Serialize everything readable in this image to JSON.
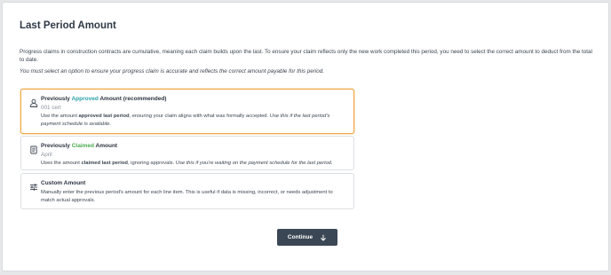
{
  "page": {
    "title": "Last Period Amount",
    "intro": "Progress claims in construction contracts are cumulative, meaning each claim builds upon the last. To ensure your claim reflects only the new work completed this period, you need to select the correct amount to deduct from the total to date.",
    "warning": "You must select an option to ensure your progress claim is accurate and reflects the correct amount payable for this period."
  },
  "options": [
    {
      "title_pre": "Previously ",
      "title_highlight": "Approved",
      "title_post": " Amount (recommended)",
      "subtitle": "001 cert",
      "desc_pre": "Use the amount ",
      "desc_bold": "approved last period",
      "desc_mid": ", ensuring your claim aligns with what was formally accepted. ",
      "desc_italic": "Use this if the last period's payment schedule is available.",
      "selected": true,
      "icon": "user-approved-icon"
    },
    {
      "title_pre": "Previously ",
      "title_highlight": "Claimed",
      "title_post": " Amount",
      "subtitle": "April",
      "desc_pre": "Uses the amount ",
      "desc_bold": "claimed last period",
      "desc_mid": ", ignoring approvals. ",
      "desc_italic": "Use this if you're waiting on the payment schedule for the last period.",
      "selected": false,
      "icon": "document-icon"
    },
    {
      "title": "Custom Amount",
      "desc": "Manually enter the previous period's amount for each line item. This is useful if data is missing, incorrect, or needs adjustment to match actual approvals.",
      "selected": false,
      "icon": "sliders-icon"
    }
  ],
  "continue_button": {
    "label": "Continue",
    "icon": "arrow-down-icon"
  },
  "colors": {
    "accent_teal": "#2aa0a8",
    "accent_green": "#4cab4f",
    "selected_border": "#f0a94a",
    "button_bg": "#3b4754"
  }
}
